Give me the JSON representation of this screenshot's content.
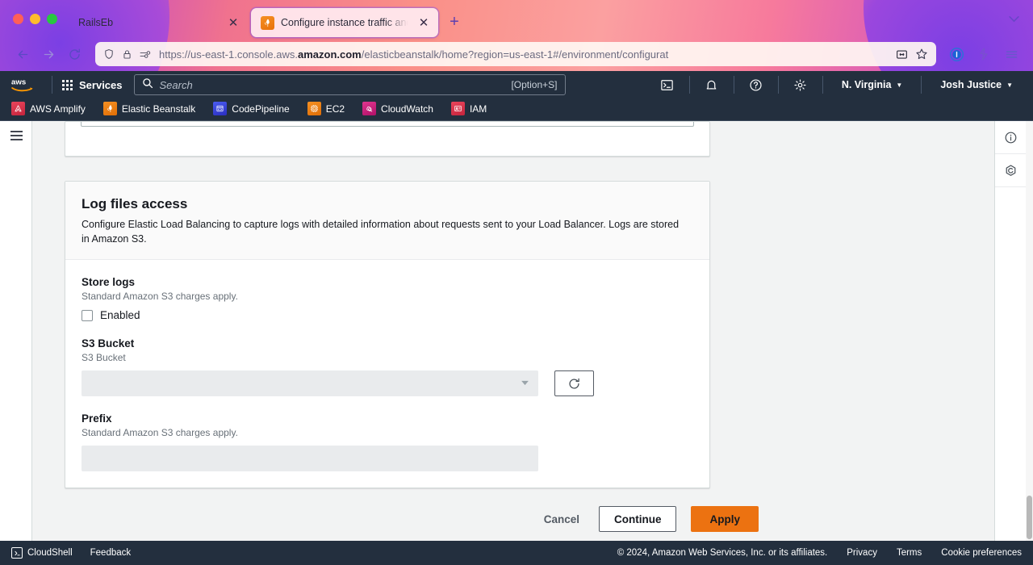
{
  "browser": {
    "tabs": [
      {
        "title": "RailsEb",
        "active": false,
        "favicon": "none"
      },
      {
        "title": "Configure instance traffic and s",
        "active": true,
        "favicon": "elastic-beanstalk-icon"
      }
    ],
    "new_tab_label": "+",
    "close_label": "✕",
    "tab_list_chevron": "⌄",
    "nav": {
      "back": "←",
      "forward": "→",
      "reload": "↻"
    },
    "url": {
      "scheme_host_pre": "https://us-east-1.console.aws.",
      "host_bold": "amazon.com",
      "path": "/elasticbeanstalk/home?region=us-east-1#/environment/configurat"
    },
    "url_icons": [
      "shield-icon",
      "lock-icon",
      "permissions-icon"
    ],
    "url_actions": [
      "reader-view-icon",
      "bookmark-star-icon"
    ],
    "toolbar_right": [
      "extension-1password-icon",
      "extension-pocket-icon",
      "app-menu-icon"
    ]
  },
  "aws_header": {
    "logo_alt": "aws",
    "services_label": "Services",
    "search": {
      "placeholder": "Search",
      "shortcut": "[Option+S]"
    },
    "icons": [
      "cloudshell-icon",
      "notifications-bell-icon",
      "help-question-icon",
      "settings-gear-icon"
    ],
    "region": "N. Virginia",
    "account": "Josh Justice",
    "caret": "▼"
  },
  "favorites": [
    {
      "label": "AWS Amplify",
      "icon": "aws-amplify-icon",
      "color": "#dd344c"
    },
    {
      "label": "Elastic Beanstalk",
      "icon": "elastic-beanstalk-icon",
      "color": "#ed7100"
    },
    {
      "label": "CodePipeline",
      "icon": "codepipeline-icon",
      "color": "#3334b9"
    },
    {
      "label": "EC2",
      "icon": "ec2-icon",
      "color": "#ed7100"
    },
    {
      "label": "CloudWatch",
      "icon": "cloudwatch-icon",
      "color": "#c7157b"
    },
    {
      "label": "IAM",
      "icon": "iam-icon",
      "color": "#dd344c"
    }
  ],
  "card": {
    "title": "Log files access",
    "description": "Configure Elastic Load Balancing to capture logs with detailed information about requests sent to your Load Balancer. Logs are stored in Amazon S3.",
    "fields": {
      "store_logs": {
        "label": "Store logs",
        "hint": "Standard Amazon S3 charges apply.",
        "checkbox_label": "Enabled",
        "checked": false
      },
      "s3_bucket": {
        "label": "S3 Bucket",
        "hint": "S3 Bucket",
        "value": "",
        "disabled": true,
        "caret": "▼",
        "refresh_icon": "refresh-icon"
      },
      "prefix": {
        "label": "Prefix",
        "hint": "Standard Amazon S3 charges apply.",
        "value": "",
        "disabled": true
      }
    }
  },
  "actions": {
    "cancel": "Cancel",
    "continue": "Continue",
    "apply": "Apply",
    "primary_color": "#ec7211"
  },
  "right_rail": {
    "items": [
      "info-circle-icon",
      "shield-hexagon-icon"
    ]
  },
  "footer": {
    "cloudshell": "CloudShell",
    "feedback": "Feedback",
    "copyright": "© 2024, Amazon Web Services, Inc. or its affiliates.",
    "privacy": "Privacy",
    "terms": "Terms",
    "cookie_preferences": "Cookie preferences"
  }
}
